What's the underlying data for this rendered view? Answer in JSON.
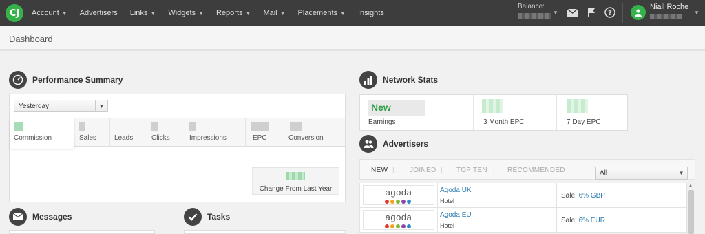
{
  "nav": {
    "logo": "CJ",
    "items": [
      {
        "label": "Account",
        "caret": true
      },
      {
        "label": "Advertisers",
        "caret": false
      },
      {
        "label": "Links",
        "caret": true
      },
      {
        "label": "Widgets",
        "caret": true
      },
      {
        "label": "Reports",
        "caret": true
      },
      {
        "label": "Mail",
        "caret": true
      },
      {
        "label": "Placements",
        "caret": true
      },
      {
        "label": "Insights",
        "caret": false
      }
    ],
    "balance_label": "Balance:",
    "user_name": "Niall Roche",
    "icons": [
      "envelope-icon",
      "flag-icon",
      "help-icon",
      "user-icon"
    ]
  },
  "page": {
    "title": "Dashboard"
  },
  "performance": {
    "title": "Performance Summary",
    "period": "Yesterday",
    "tabs": [
      "Commission",
      "Sales",
      "Leads",
      "Clicks",
      "Impressions",
      "EPC",
      "Conversion"
    ],
    "active_tab": "Commission",
    "change_label": "Change From Last Year"
  },
  "network": {
    "title": "Network Stats",
    "earnings_value": "New",
    "earnings_label": "Earnings",
    "epc3_label": "3 Month EPC",
    "epc7_label": "7 Day EPC"
  },
  "advertisers": {
    "title": "Advertisers",
    "tabs": [
      "NEW",
      "JOINED",
      "TOP TEN",
      "RECOMMENDED"
    ],
    "active_tab": "NEW",
    "filter": "All",
    "rows": [
      {
        "logo_text": "agoda",
        "name": "Agoda UK",
        "category": "Hotel",
        "sale_label": "Sale:",
        "sale_value": "6% GBP"
      },
      {
        "logo_text": "agoda",
        "name": "Agoda EU",
        "category": "Hotel",
        "sale_label": "Sale:",
        "sale_value": "6% EUR"
      }
    ]
  },
  "messages": {
    "title": "Messages"
  },
  "tasks": {
    "title": "Tasks"
  },
  "colors": {
    "brand_green": "#36b24b",
    "nav_bg": "#3d3d3d",
    "link_blue": "#2a7ab0"
  }
}
